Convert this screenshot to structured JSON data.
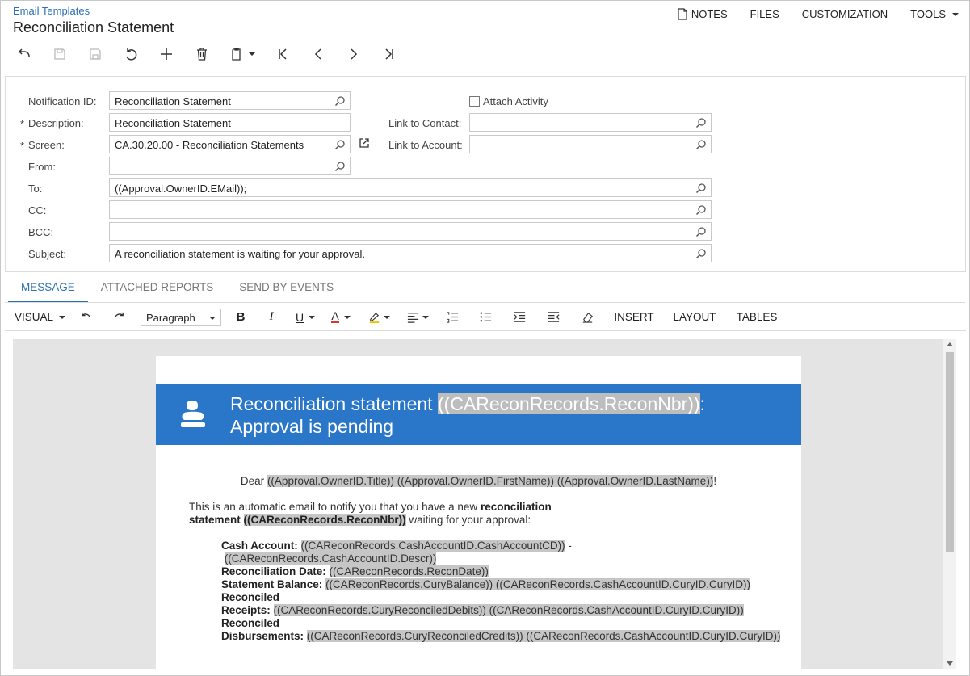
{
  "header": {
    "breadcrumb": "Email Templates",
    "title": "Reconciliation Statement",
    "menu": {
      "notes": "NOTES",
      "files": "FILES",
      "customization": "CUSTOMIZATION",
      "tools": "TOOLS"
    }
  },
  "form": {
    "notification_id": {
      "label": "Notification ID:",
      "value": "Reconciliation Statement"
    },
    "description": {
      "label": "Description:",
      "value": "Reconciliation Statement"
    },
    "screen": {
      "label": "Screen:",
      "value": "CA.30.20.00 - Reconciliation Statements"
    },
    "from": {
      "label": "From:",
      "value": ""
    },
    "to": {
      "label": "To:",
      "value": "((Approval.OwnerID.EMail));"
    },
    "cc": {
      "label": "CC:",
      "value": ""
    },
    "bcc": {
      "label": "BCC:",
      "value": ""
    },
    "subject": {
      "label": "Subject:",
      "value": "A reconciliation statement is waiting for your approval."
    },
    "attach_activity": {
      "label": "Attach Activity",
      "checked": false
    },
    "link_to_contact": {
      "label": "Link to Contact:",
      "value": ""
    },
    "link_to_account": {
      "label": "Link to Account:",
      "value": ""
    },
    "required_mark": "*"
  },
  "tabs": [
    "MESSAGE",
    "ATTACHED REPORTS",
    "SEND BY EVENTS"
  ],
  "editor_toolbar": {
    "mode": "VISUAL",
    "paragraph": "Paragraph",
    "bold": "B",
    "italic": "I",
    "underline": "U",
    "font_color": "A",
    "insert": "INSERT",
    "layout": "LAYOUT",
    "tables": "TABLES"
  },
  "email": {
    "title_text": "Reconciliation statement ",
    "title_token": "((CAReconRecords.ReconNbr))",
    "title_colon": ":",
    "title_line2": "Approval is pending",
    "dear": "Dear ",
    "dear_tokens": "((Approval.OwnerID.Title)) ((Approval.OwnerID.FirstName)) ((Approval.OwnerID.LastName))",
    "dear_end": "!",
    "intro_1": "This is an automatic email to notify you that you have a new ",
    "intro_bold": "reconciliation statement",
    "intro_token": "((CAReconRecords.ReconNbr))",
    "intro_2": " waiting for your approval:",
    "cash_account_label": "Cash Account:",
    "cash_account_token": "((CAReconRecords.CashAccountID.CashAccountCD))",
    "cash_account_sep": " -",
    "cash_account_desc": "((CAReconRecords.CashAccountID.Descr))",
    "recon_date_label": "Reconciliation Date:",
    "recon_date_token": "((CAReconRecords.ReconDate))",
    "stmt_balance_label": "Statement Balance:",
    "stmt_balance_token": "((CAReconRecords.CuryBalance)) ((CAReconRecords.CashAccountID.CuryID.CuryID))",
    "receipts_label_1": "Reconciled",
    "receipts_label_2": "Receipts:",
    "receipts_token": "((CAReconRecords.CuryReconciledDebits)) ((CAReconRecords.CashAccountID.CuryID.CuryID))",
    "disb_label_1": "Reconciled",
    "disb_label_2": "Disbursements:",
    "disb_token": "((CAReconRecords.CuryReconciledCredits)) ((CAReconRecords.CashAccountID.CuryID.CuryID))"
  },
  "colors": {
    "accent": "#2b6fb6",
    "banner": "#2a77c9",
    "token_highlight": "#c6c6c6"
  }
}
